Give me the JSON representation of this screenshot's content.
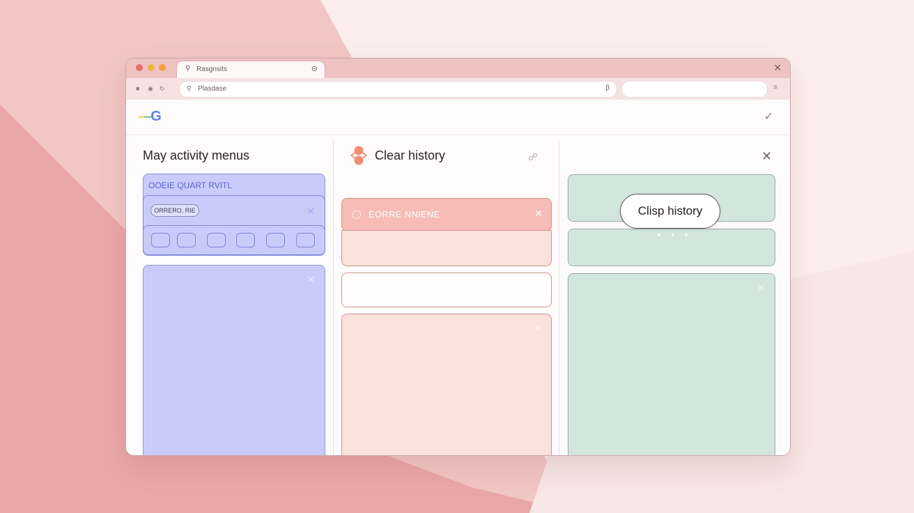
{
  "colors": {
    "background_light": "#fbeeec",
    "background_rose": "#e8a7a8",
    "panel_purple": "#c9ccfb",
    "panel_salmon": "#f6bcb5",
    "panel_peach": "#fbe2dc",
    "panel_green": "#d3e6dd",
    "traffic_red": "#ee6f6a",
    "traffic_yellow": "#f0b73e",
    "traffic_orange": "#f0a23c"
  },
  "browser": {
    "tab_title": "Rasgnsits",
    "address_text": "Plasdase",
    "icons": {
      "tab": "lock-icon",
      "close": "close-icon",
      "back": "back-icon",
      "forward": "forward-icon",
      "reload": "reload-icon",
      "bookmark": "bookmark-icon",
      "menu": "menu-icon"
    }
  },
  "page": {
    "logo_text": "G",
    "pin_icon": "pin-icon"
  },
  "panel_left": {
    "title": "May activity menus",
    "card_header": "OOEIE QUART RVITL",
    "chip_label": "ORRERO, RIE"
  },
  "panel_middle": {
    "title": "Clear history",
    "card_header": "EORRE NNIENE"
  },
  "panel_right": {
    "pill_label": "Clisp history",
    "dots": "• • •"
  }
}
